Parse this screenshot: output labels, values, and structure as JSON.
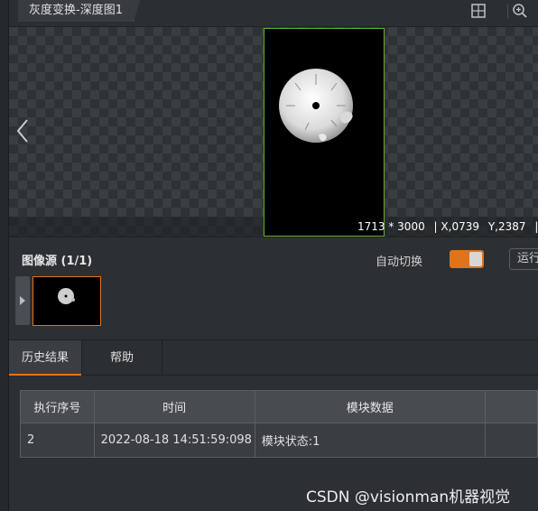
{
  "window": {
    "tab_title": "灰度变换-深度图1"
  },
  "toolbar": {
    "fit_icon": "fit-frame-icon",
    "zoom_icon": "zoom-in-icon"
  },
  "viewer": {
    "resolution": "1713 * 3000",
    "coord_x": "| X,0739",
    "coord_y": "Y,2387",
    "trailing": "| R",
    "frame_color": "#5fae2e"
  },
  "image_source": {
    "title": "图像源 (1/1)",
    "auto_switch_label": "自动切换",
    "auto_switch_on": true,
    "run_label": "运行",
    "accent": "#e0741a"
  },
  "bottom_tabs": [
    {
      "label": "历史结果",
      "active": true
    },
    {
      "label": "帮助",
      "active": false
    }
  ],
  "results_table": {
    "headers": [
      "执行序号",
      "时间",
      "模块数据",
      ""
    ],
    "rows": [
      [
        "2",
        "2022-08-18 14:51:59:098",
        "模块状态:1",
        ""
      ]
    ]
  },
  "watermark": "CSDN @visionman机器视觉"
}
